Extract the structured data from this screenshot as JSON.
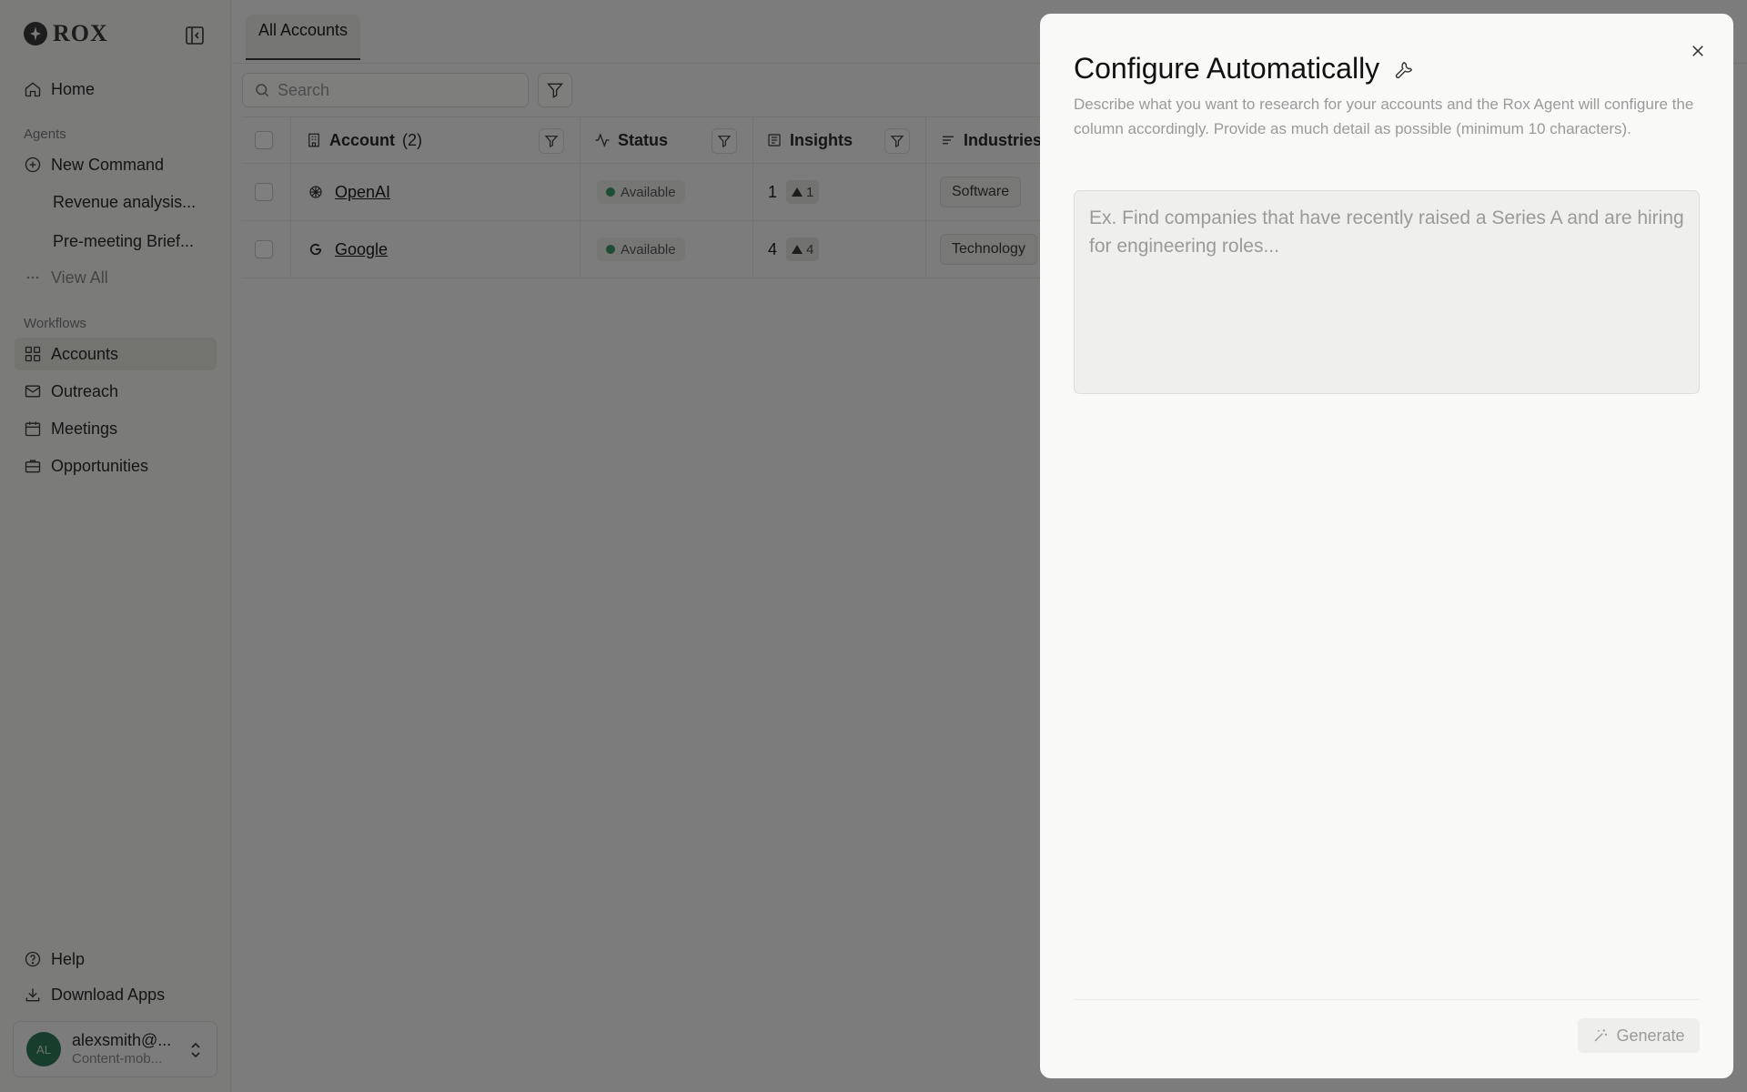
{
  "sidebar": {
    "logo_text": "ROX",
    "nav": {
      "home": "Home",
      "agents_label": "Agents",
      "new_command": "New Command",
      "revenue": "Revenue analysis...",
      "premeeting": "Pre-meeting Brief...",
      "view_all": "View All",
      "workflows_label": "Workflows",
      "accounts": "Accounts",
      "outreach": "Outreach",
      "meetings": "Meetings",
      "opportunities": "Opportunities",
      "help": "Help",
      "download": "Download Apps"
    },
    "user": {
      "initials": "AL",
      "email": "alexsmith@...",
      "org": "Content-mob..."
    }
  },
  "main": {
    "tab": "All Accounts",
    "search_placeholder": "Search",
    "columns": {
      "account": "Account",
      "account_count": "(2)",
      "status": "Status",
      "insights": "Insights",
      "industries": "Industries"
    },
    "rows": [
      {
        "name": "OpenAI",
        "status": "Available",
        "insights": "1",
        "insights_badge": "1",
        "industry": "Software"
      },
      {
        "name": "Google",
        "status": "Available",
        "insights": "4",
        "insights_badge": "4",
        "industry": "Technology"
      }
    ]
  },
  "modal": {
    "title": "Configure Automatically",
    "description": "Describe what you want to research for your accounts and the Rox Agent will configure the column accordingly. Provide as much detail as possible (minimum 10 characters).",
    "placeholder": "Ex. Find companies that have recently raised a Series A and are hiring for engineering roles...",
    "generate": "Generate"
  },
  "colors": {
    "accent_green": "#3d9a6c",
    "overlay": "rgba(0,0,0,0.5)"
  }
}
